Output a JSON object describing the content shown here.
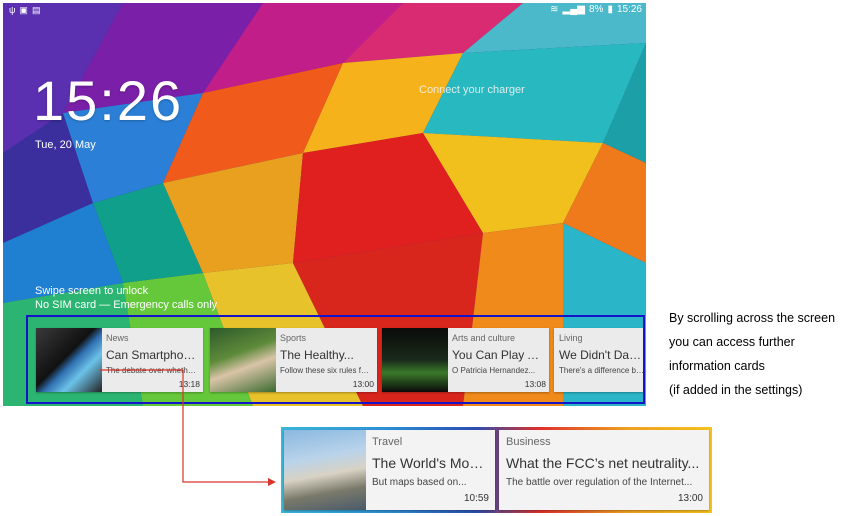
{
  "colors": {
    "highlight_frame": "#1414c8",
    "arrow": "#d9342b",
    "card_background": "#ebebeb"
  },
  "status_bar": {
    "left_icons": [
      "usb-icon",
      "image-icon",
      "sd-card-icon"
    ],
    "right_icons": [
      "wifi-icon",
      "signal-icon"
    ],
    "battery": "8%",
    "time": "15:26"
  },
  "lock_screen": {
    "clock": "15:26",
    "date": "Tue, 20 May",
    "charger_message": "Connect your charger",
    "unlock_hint": "Swipe screen to unlock",
    "sim_status": "No SIM card — Emergency calls only"
  },
  "cards": [
    {
      "category": "News",
      "title": "Can Smartphone...",
      "description": "The debate over whether...",
      "time": "13:18"
    },
    {
      "category": "Sports",
      "title": "The Healthy...",
      "description": "Follow these six rules for ...",
      "time": "13:00"
    },
    {
      "category": "Arts and culture",
      "title": "You Can Play As...",
      "description": "O Patricia Hernandez...",
      "time": "13:08"
    },
    {
      "category": "Living",
      "title": "We Didn't Date, Bu",
      "description": "There's a difference betw",
      "time": ""
    }
  ],
  "zoomed_cards": [
    {
      "category": "Travel",
      "title": "The World's Most...",
      "description": "But maps based on...",
      "time": "10:59"
    },
    {
      "category": "Business",
      "title": "What the FCC’s net neutrality...",
      "description": "The battle over regulation of the Internet...",
      "time": "13:00"
    }
  ],
  "annotation": {
    "line1": "By scrolling across the screen",
    "line2": "you can access further",
    "line3": "information cards",
    "line4": "(if added in the settings)"
  }
}
